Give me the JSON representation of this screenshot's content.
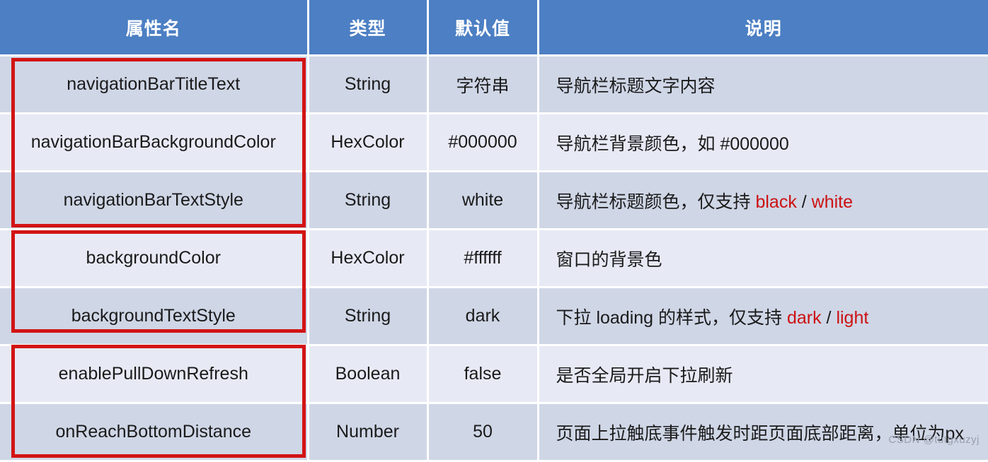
{
  "table": {
    "columns": [
      {
        "key": "name",
        "label": "属性名"
      },
      {
        "key": "type",
        "label": "类型"
      },
      {
        "key": "default",
        "label": "默认值"
      },
      {
        "key": "desc",
        "label": "说明"
      }
    ],
    "rows": [
      {
        "name": "navigationBarTitleText",
        "type": "String",
        "default": "字符串",
        "desc_prefix": "导航栏标题文字内容",
        "desc_kw1": "",
        "desc_sep": "",
        "desc_kw2": "",
        "desc_suffix": ""
      },
      {
        "name": "navigationBarBackgroundColor",
        "type": "HexColor",
        "default": "#000000",
        "desc_prefix": "导航栏背景颜色，如 #000000",
        "desc_kw1": "",
        "desc_sep": "",
        "desc_kw2": "",
        "desc_suffix": ""
      },
      {
        "name": "navigationBarTextStyle",
        "type": "String",
        "default": "white",
        "desc_prefix": "导航栏标题颜色，仅支持 ",
        "desc_kw1": "black",
        "desc_sep": " / ",
        "desc_kw2": "white",
        "desc_suffix": ""
      },
      {
        "name": "backgroundColor",
        "type": "HexColor",
        "default": "#ffffff",
        "desc_prefix": "窗口的背景色",
        "desc_kw1": "",
        "desc_sep": "",
        "desc_kw2": "",
        "desc_suffix": ""
      },
      {
        "name": "backgroundTextStyle",
        "type": "String",
        "default": "dark",
        "desc_prefix": "下拉 loading 的样式，仅支持 ",
        "desc_kw1": "dark",
        "desc_sep": " / ",
        "desc_kw2": "light",
        "desc_suffix": ""
      },
      {
        "name": "enablePullDownRefresh",
        "type": "Boolean",
        "default": "false",
        "desc_prefix": "是否全局开启下拉刷新",
        "desc_kw1": "",
        "desc_sep": "",
        "desc_kw2": "",
        "desc_suffix": ""
      },
      {
        "name": "onReachBottomDistance",
        "type": "Number",
        "default": "50",
        "desc_prefix": "页面上拉触底事件触发时距页面底部距离，单位为px",
        "desc_kw1": "",
        "desc_sep": "",
        "desc_kw2": "",
        "desc_suffix": ""
      }
    ]
  },
  "annotations": {
    "boxes": [
      {
        "id": "redbox-1",
        "covers": "navigation-bar-properties"
      },
      {
        "id": "redbox-2",
        "covers": "background-properties"
      },
      {
        "id": "redbox-3",
        "covers": "pull-down-properties"
      }
    ],
    "color": "#D21414"
  },
  "watermark": {
    "text": "CSDN @tutgxuzyj"
  },
  "colors": {
    "header_blue": "#4C7FC3",
    "row_odd": "#CFD6E6",
    "row_even": "#E7EAF5",
    "keyword_red": "#CC1111",
    "annotation_red": "#D21414",
    "text": "#1a1a1a"
  }
}
